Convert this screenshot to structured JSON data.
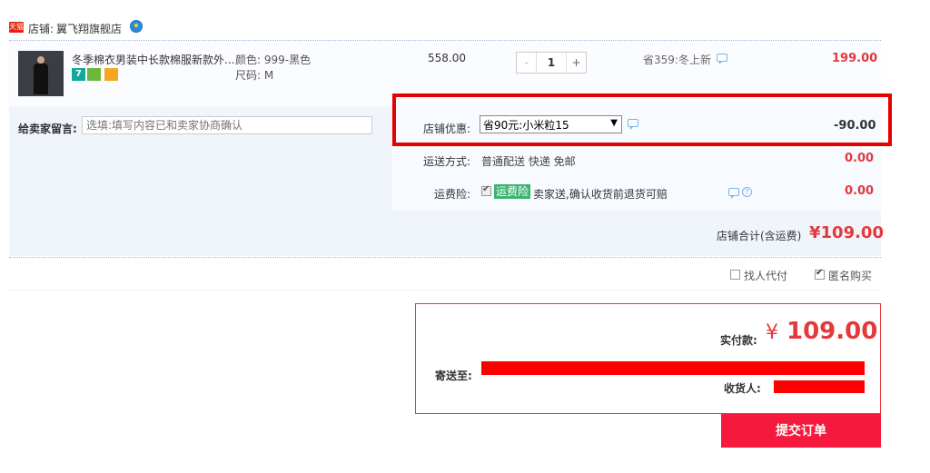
{
  "shop": {
    "badge": "天猫",
    "label": "店铺:",
    "name": "翼飞翔旗舰店"
  },
  "item": {
    "title": "冬季棉衣男装中长款棉服新款外...",
    "tags": [
      "7",
      "",
      ""
    ],
    "sku_color": "颜色: 999-黑色",
    "sku_size": "尺码: M",
    "price": "558.00",
    "quantity": "1",
    "qty_minus": "-",
    "qty_plus": "+",
    "promotion": "省359:冬上新",
    "subtotal": "199.00"
  },
  "message": {
    "label": "给卖家留言:",
    "placeholder": "选填:填写内容已和卖家协商确认"
  },
  "coupon": {
    "label": "店铺优惠:",
    "selected": "省90元:小米粒15",
    "amount": "-90.00"
  },
  "shipping": {
    "label": "运送方式:",
    "value": "普通配送 快递 免邮",
    "amount": "0.00"
  },
  "insurance": {
    "label": "运费险:",
    "badge": "运费险",
    "text": "卖家送,确认收货前退货可赔",
    "amount": "0.00"
  },
  "shop_total": {
    "label": "店铺合计(含运费)",
    "amount": "¥109.00"
  },
  "options": {
    "proxy_pay": "找人代付",
    "anonymous": "匿名购买"
  },
  "summary": {
    "pay_label": "实付款:",
    "currency": "¥",
    "pay_amount": "109.00",
    "ship_to_label": "寄送至:",
    "receiver_label": "收货人:"
  },
  "submit_label": "提交订单",
  "colors": {
    "accent": "#e4393c",
    "submit": "#f5193d",
    "highlight_frame": "#e60000",
    "insurance_badge": "#3cb371"
  }
}
